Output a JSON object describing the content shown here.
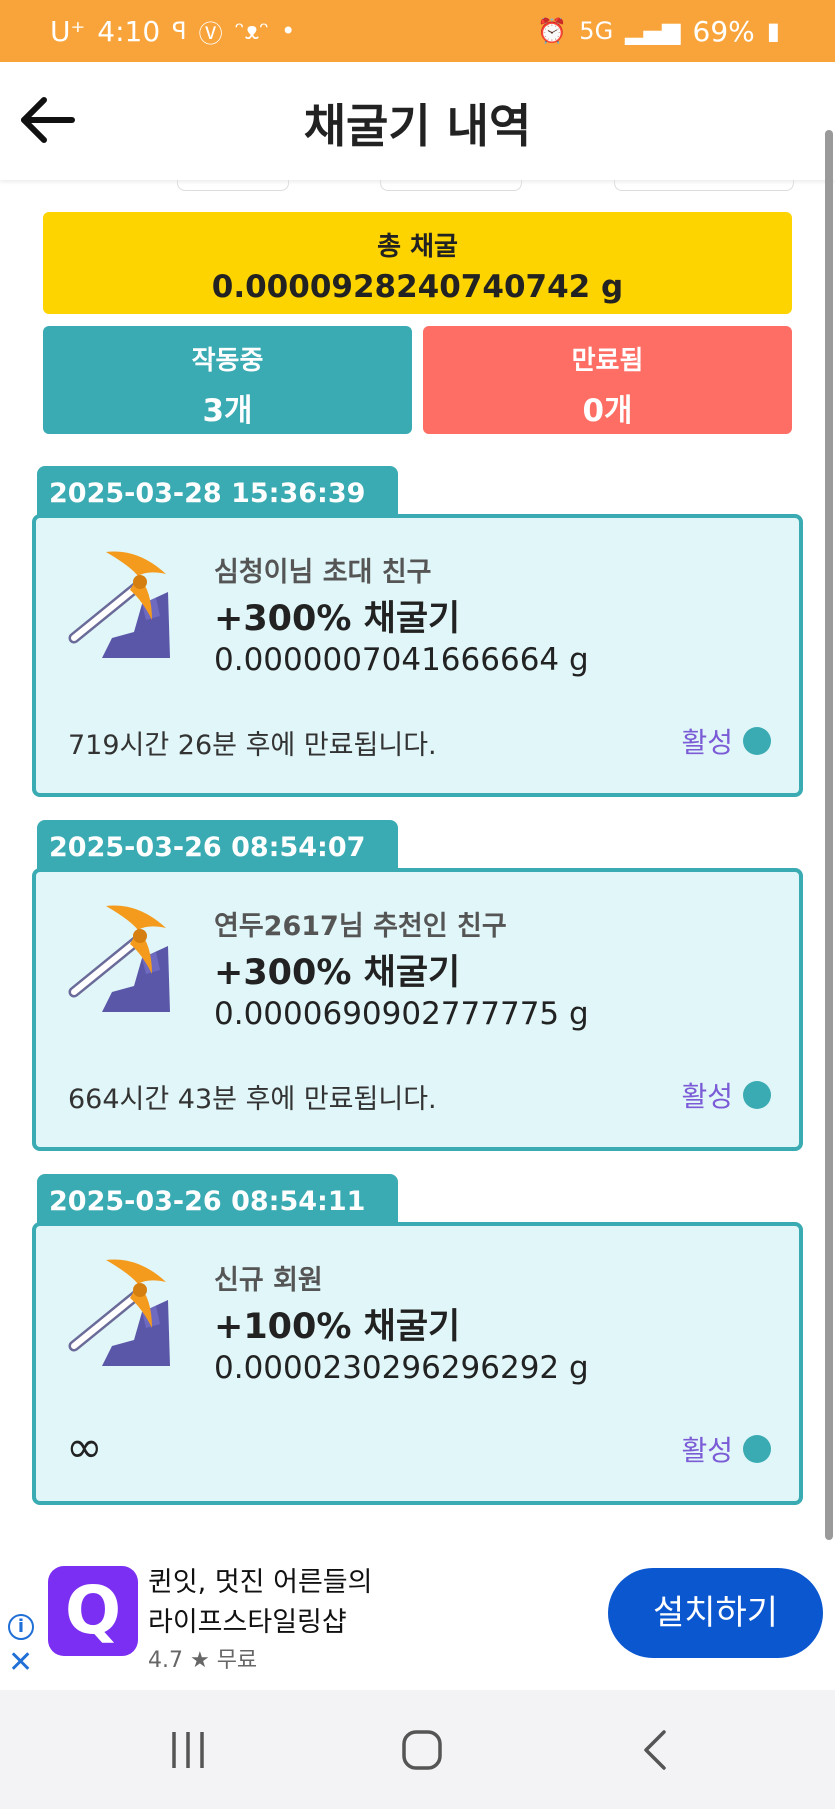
{
  "status_bar": {
    "carrier": "U⁺",
    "time": "4:10",
    "battery": "69%",
    "network": "5G"
  },
  "header": {
    "title": "채굴기 내역"
  },
  "summary": {
    "total_label": "총 채굴",
    "total_value": "0.0000928240740742 g",
    "active_label": "작동중",
    "active_count": "3개",
    "expired_label": "만료됨",
    "expired_count": "0개"
  },
  "entries": [
    {
      "date": "2025-03-28 15:36:39",
      "subtitle": "심청이님 초대 친구",
      "title": "+300% 채굴기",
      "amount": "0.0000007041666664 g",
      "expire": "719시간 26분 후에 만료됩니다.",
      "status": "활성"
    },
    {
      "date": "2025-03-26 08:54:07",
      "subtitle": "연두2617님 추천인 친구",
      "title": "+300% 채굴기",
      "amount": "0.0000690902777775 g",
      "expire": "664시간 43분 후에 만료됩니다.",
      "status": "활성"
    },
    {
      "date": "2025-03-26 08:54:11",
      "subtitle": "신규 회원",
      "title": "+100% 채굴기",
      "amount": "0.0000230296296292 g",
      "expire": "∞",
      "status": "활성"
    }
  ],
  "ad": {
    "logo_letter": "Q",
    "line1": "퀸잇, 멋진 어른들의",
    "line2": "라이프스타일링샵",
    "rating": "4.7 ★ 무료",
    "install_label": "설치하기"
  },
  "colors": {
    "accent_teal": "#3aabb3",
    "gold": "#fdd400",
    "expired_red": "#fe6e64",
    "status_purple": "#7b5cd6"
  }
}
